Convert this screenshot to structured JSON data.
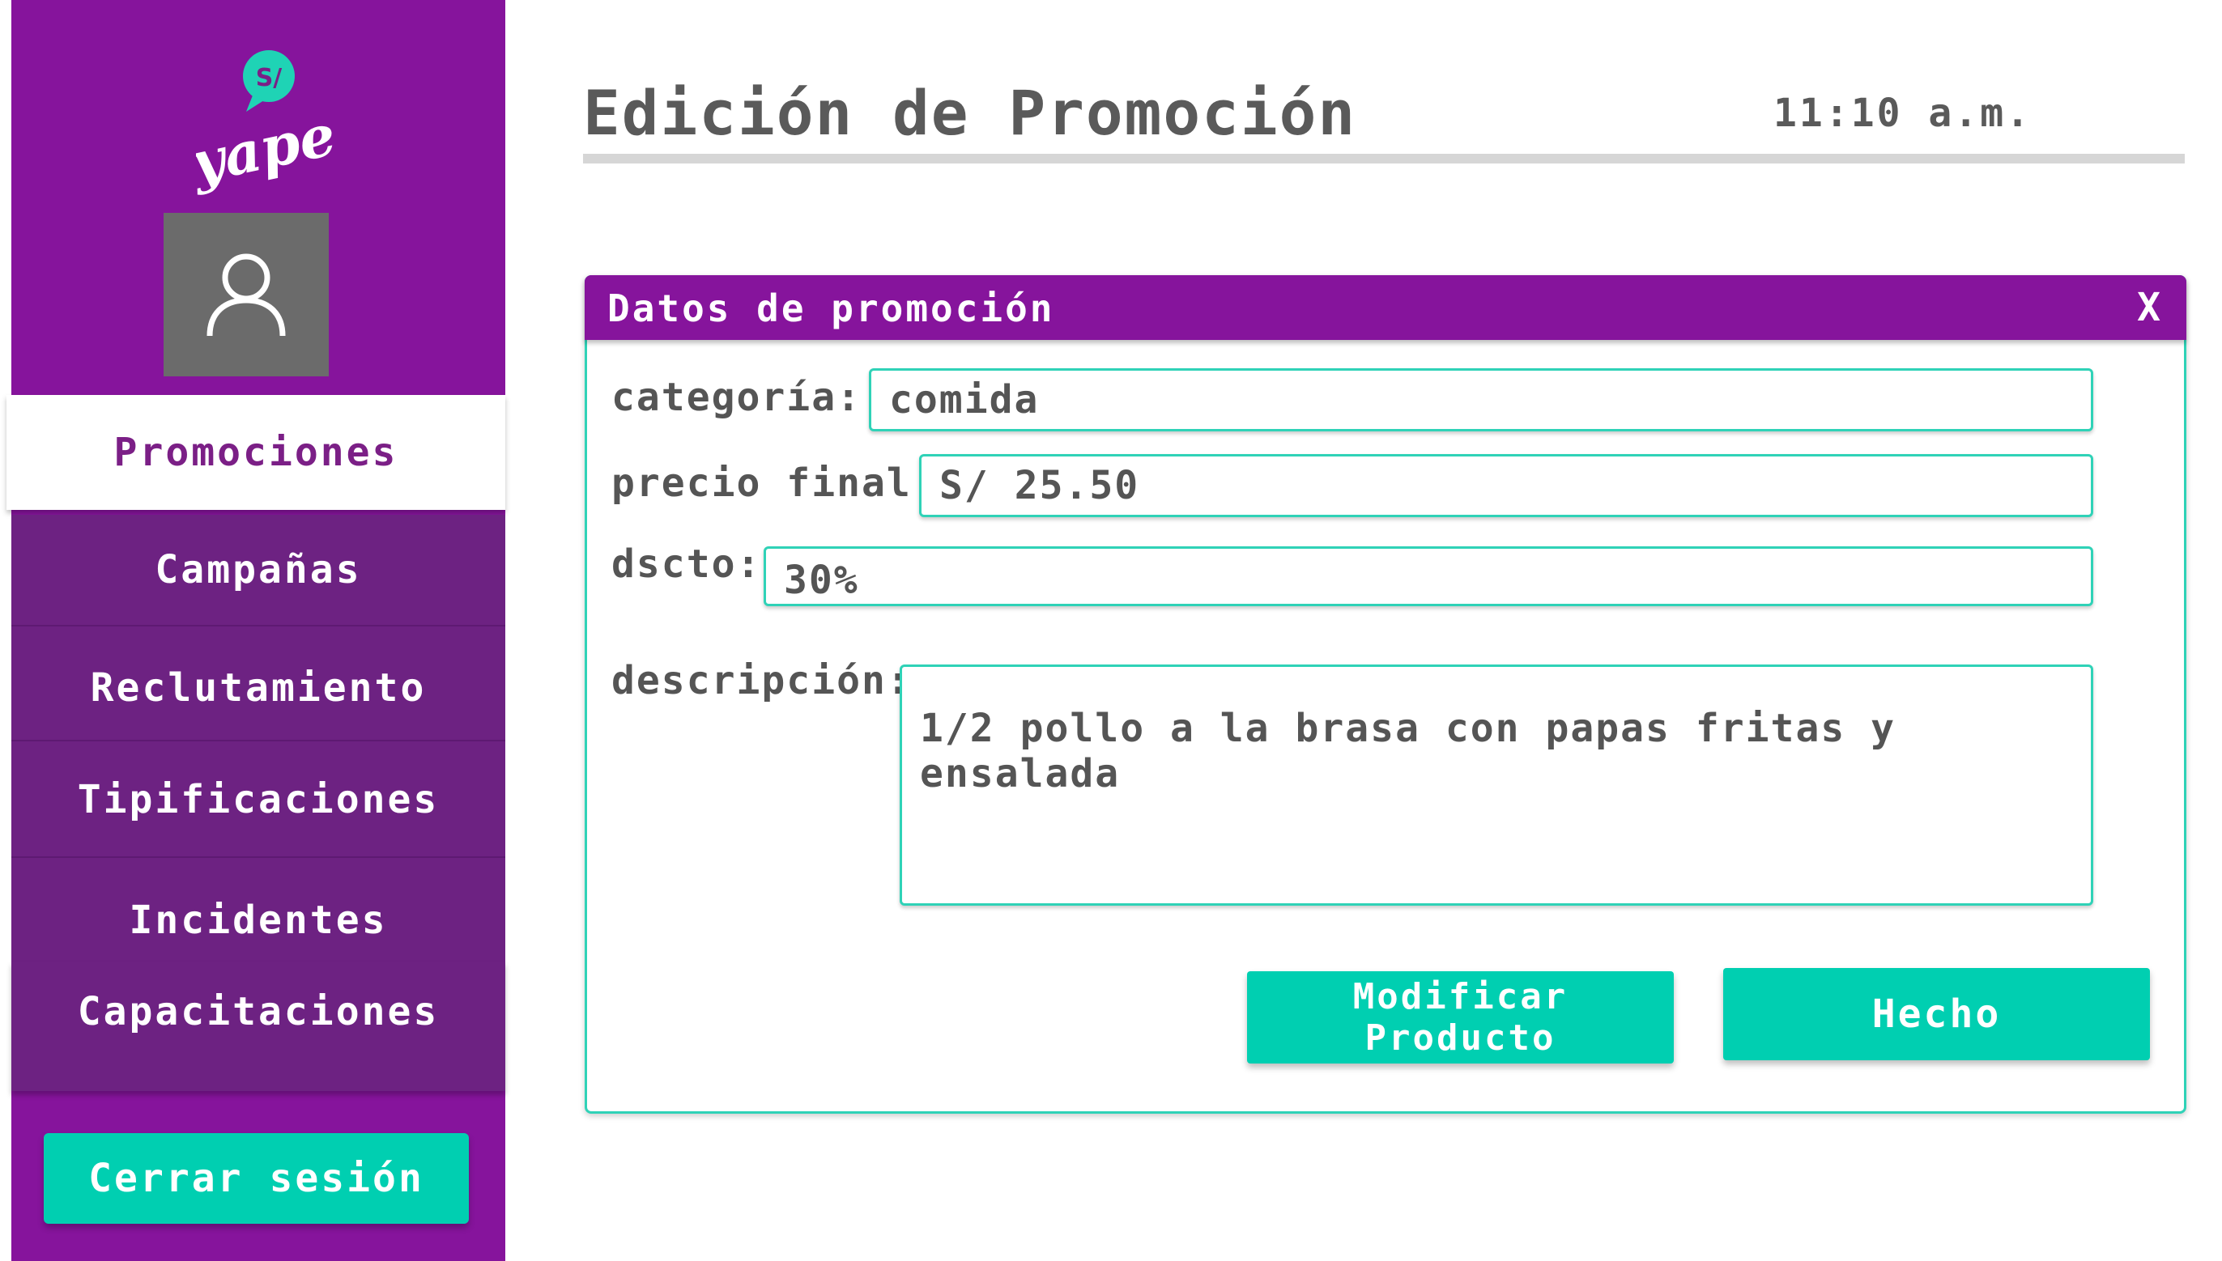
{
  "app": {
    "brand": "yape",
    "brand_badge": "S/"
  },
  "colors": {
    "brand_purple": "#86149c",
    "accent_teal": "#00cfb1",
    "text_gray": "#555555"
  },
  "sidebar": {
    "items": [
      {
        "label": "Promociones",
        "active": true
      },
      {
        "label": "Campañas",
        "active": false
      },
      {
        "label": "Reclutamiento",
        "active": false
      },
      {
        "label": "Tipificaciones",
        "active": false
      },
      {
        "label": "Incidentes",
        "active": false
      },
      {
        "label": "Capacitaciones",
        "active": false
      }
    ],
    "logout_label": "Cerrar sesión",
    "avatar_icon": "user-icon"
  },
  "header": {
    "title": "Edición de Promoción",
    "time": "11:10 a.m."
  },
  "dialog": {
    "title": "Datos de promoción",
    "close_label": "X",
    "fields": {
      "categoria": {
        "label": "categoría:",
        "value": "comida"
      },
      "precio": {
        "label": "precio final:",
        "value": "S/ 25.50"
      },
      "dscto": {
        "label": "dscto:",
        "value": "30%"
      },
      "descripcion": {
        "label": "descripción:",
        "value": "1/2 pollo a la brasa con papas fritas y ensalada"
      }
    },
    "buttons": {
      "modify": "Modificar Producto",
      "done": "Hecho"
    }
  }
}
